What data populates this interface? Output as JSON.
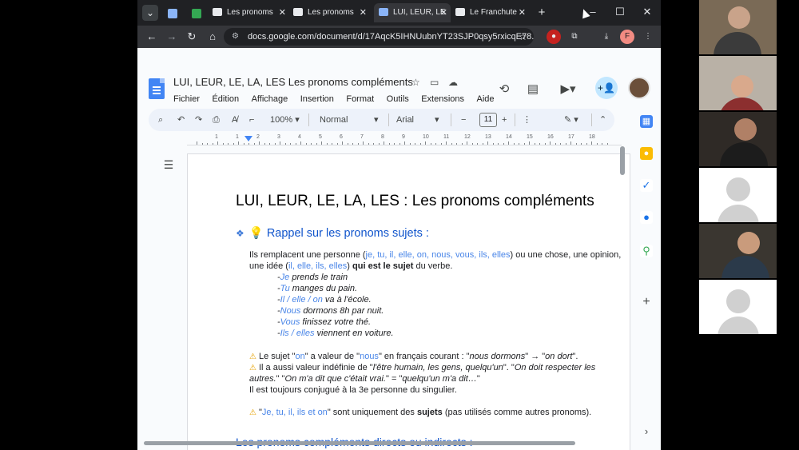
{
  "browser": {
    "tabs": [
      {
        "label": "Les pronoms",
        "favicon_color": "#1a73e8"
      },
      {
        "label": "Les pronoms",
        "favicon_color": "#1a73e8"
      },
      {
        "label": "LUI, LEUR, LE",
        "favicon_color": "#4285f4"
      },
      {
        "label": "Le Franchute",
        "favicon_color": "#ffffff"
      }
    ],
    "new_tab_label": "+",
    "url": "docs.google.com/document/d/17AqcK5IHNUubnYT23SJP0qsy5rxicqE78...",
    "profile_initial": "F"
  },
  "docs": {
    "title": "LUI, LEUR, LE, LA, LES Les pronoms compléments",
    "menu": [
      "Fichier",
      "Édition",
      "Affichage",
      "Insertion",
      "Format",
      "Outils",
      "Extensions",
      "Aide"
    ],
    "toolbar": {
      "zoom": "100%",
      "style": "Normal",
      "font": "Arial",
      "font_size": "11"
    },
    "ruler_numbers": [
      "1",
      "1",
      "2",
      "3",
      "4",
      "5",
      "6",
      "7",
      "8",
      "9",
      "10",
      "11",
      "12",
      "13",
      "14",
      "15",
      "16",
      "17",
      "18"
    ]
  },
  "document": {
    "heading": "LUI, LEUR, LE, LA, LES : Les pronoms compléments",
    "section1_title": "Rappel sur les pronoms sujets :",
    "intro_line1_a": "Ils remplacent une personne (",
    "intro_line1_pronouns": "je, tu, il, elle, on, nous, vous, ils, elles",
    "intro_line1_b": ") ou une chose, une opinion,",
    "intro_line2_a": "une idée (",
    "intro_line2_pronouns": "il, elle, ils, elles",
    "intro_line2_b": ") ",
    "intro_line2_bold": "qui est le sujet",
    "intro_line2_c": " du verbe.",
    "examples": [
      {
        "pronoun": "Je",
        "rest": " prends le train"
      },
      {
        "pronoun": "Tu",
        "rest": " manges du pain."
      },
      {
        "pronoun": "Il / elle / on",
        "rest": " va à l'école."
      },
      {
        "pronoun": "Nous",
        "rest": " dormons 8h par nuit."
      },
      {
        "pronoun": "Vous",
        "rest": " finissez votre thé."
      },
      {
        "pronoun": "Ils / elles",
        "rest": " viennent en voiture."
      }
    ],
    "note1_a": "Le sujet \"",
    "note1_on": "on",
    "note1_b": "\" a valeur de \"",
    "note1_nous": "nous",
    "note1_c": "\" en français courant : \"",
    "note1_ex1": "nous dormons",
    "note1_d": "\" → \"",
    "note1_ex2": "on dort",
    "note1_e": "\".",
    "note2_a": "Il a aussi valeur indéfinie de \"",
    "note2_b": "l'être humain, les gens, quelqu'un",
    "note2_c": "\". \"",
    "note2_d": "On doit respecter les",
    "note3_a": "autres.",
    "note3_b": "\" \"",
    "note3_c": "On m'a dit que c'était vrai.",
    "note3_d": "\" = \"",
    "note3_e": "quelqu'un m'a dit…",
    "note3_f": "\"",
    "note4": "Il est toujours conjugué à la 3e personne du singulier.",
    "note5_a": "\"",
    "note5_pronouns": "Je, tu, il, ils et on",
    "note5_b": "\" sont uniquement des ",
    "note5_bold": "sujets",
    "note5_c": " (pas utilisés comme autres pronoms).",
    "section2_title": "Les pronoms compléments directs ou indirects :"
  },
  "colors": {
    "accent_blue": "#4a86e8",
    "heading_blue": "#1155cc",
    "warning": "#e6a100"
  }
}
